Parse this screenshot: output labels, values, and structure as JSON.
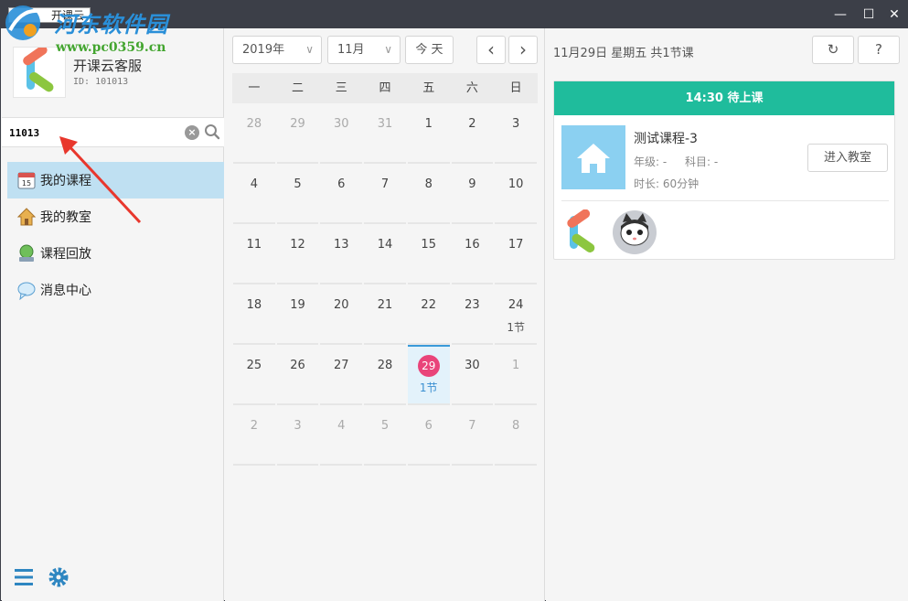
{
  "window": {
    "title": "开课云",
    "minimize": "—",
    "maximize": "☐",
    "close": "✕"
  },
  "watermark": {
    "site_name": "河东软件园",
    "site_url": "www.pc0359.cn"
  },
  "profile": {
    "name": "开课云客服",
    "id": "ID: 101013"
  },
  "search": {
    "value": "11013",
    "clear": "×"
  },
  "nav": {
    "items": [
      {
        "label": "我的课程"
      },
      {
        "label": "我的教室"
      },
      {
        "label": "课程回放"
      },
      {
        "label": "消息中心"
      }
    ]
  },
  "calendar": {
    "year": "2019年",
    "month": "11月",
    "today_label": "今 天",
    "prev": "‹",
    "next": "›",
    "chevron": "∨",
    "weekdays": [
      "一",
      "二",
      "三",
      "四",
      "五",
      "六",
      "日"
    ],
    "days": [
      {
        "n": "28",
        "other": true
      },
      {
        "n": "29",
        "other": true
      },
      {
        "n": "30",
        "other": true
      },
      {
        "n": "31",
        "other": true
      },
      {
        "n": "1"
      },
      {
        "n": "2"
      },
      {
        "n": "3"
      },
      {
        "n": "4"
      },
      {
        "n": "5"
      },
      {
        "n": "6"
      },
      {
        "n": "7"
      },
      {
        "n": "8"
      },
      {
        "n": "9"
      },
      {
        "n": "10"
      },
      {
        "n": "11"
      },
      {
        "n": "12"
      },
      {
        "n": "13"
      },
      {
        "n": "14"
      },
      {
        "n": "15"
      },
      {
        "n": "16"
      },
      {
        "n": "17"
      },
      {
        "n": "18"
      },
      {
        "n": "19"
      },
      {
        "n": "20"
      },
      {
        "n": "21"
      },
      {
        "n": "22"
      },
      {
        "n": "23"
      },
      {
        "n": "24",
        "count": "1节"
      },
      {
        "n": "25"
      },
      {
        "n": "26"
      },
      {
        "n": "27"
      },
      {
        "n": "28"
      },
      {
        "n": "29",
        "today": true,
        "count": "1节"
      },
      {
        "n": "30"
      },
      {
        "n": "1",
        "other": true
      },
      {
        "n": "2",
        "other": true
      },
      {
        "n": "3",
        "other": true
      },
      {
        "n": "4",
        "other": true
      },
      {
        "n": "5",
        "other": true
      },
      {
        "n": "6",
        "other": true
      },
      {
        "n": "7",
        "other": true
      },
      {
        "n": "8",
        "other": true
      }
    ]
  },
  "panel": {
    "header": "11月29日 星期五 共1节课",
    "refresh": "↻",
    "help": "?",
    "card": {
      "status": "14:30  待上课",
      "course_title": "测试课程-3",
      "grade": "年级: -",
      "subject": "科目: -",
      "duration": "时长: 60分钟",
      "enter_label": "进入教室"
    }
  },
  "colors": {
    "accent": "#1fbc9c",
    "selected_nav": "#bfe0f2",
    "today_badge": "#e9447a",
    "titlebar": "#3c3f48"
  }
}
